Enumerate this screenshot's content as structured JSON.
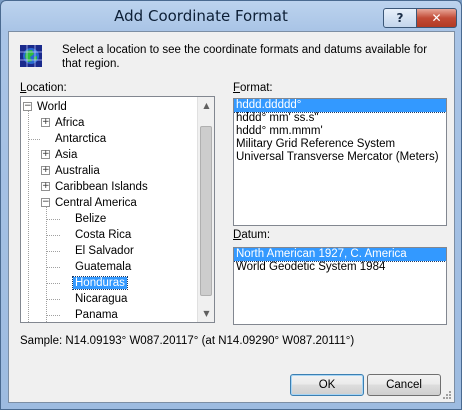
{
  "window": {
    "title": "Add Coordinate Format",
    "help_label": "?",
    "close_label": "✕"
  },
  "intro": {
    "icon": "globe-grid-icon",
    "text": "Select a location to see the coordinate formats and datums available for that region."
  },
  "location": {
    "label_hotkey": "L",
    "label_rest": "ocation:",
    "tree": [
      {
        "label": "World",
        "expander": "−",
        "depth": 0
      },
      {
        "label": "Africa",
        "expander": "+",
        "depth": 1
      },
      {
        "label": "Antarctica",
        "expander": "",
        "depth": 1
      },
      {
        "label": "Asia",
        "expander": "+",
        "depth": 1
      },
      {
        "label": "Australia",
        "expander": "+",
        "depth": 1
      },
      {
        "label": "Caribbean Islands",
        "expander": "+",
        "depth": 1
      },
      {
        "label": "Central America",
        "expander": "−",
        "depth": 1
      },
      {
        "label": "Belize",
        "expander": "",
        "depth": 2
      },
      {
        "label": "Costa Rica",
        "expander": "",
        "depth": 2
      },
      {
        "label": "El Salvador",
        "expander": "",
        "depth": 2
      },
      {
        "label": "Guatemala",
        "expander": "",
        "depth": 2
      },
      {
        "label": "Honduras",
        "expander": "",
        "depth": 2,
        "selected": true
      },
      {
        "label": "Nicaragua",
        "expander": "",
        "depth": 2
      },
      {
        "label": "Panama",
        "expander": "",
        "depth": 2
      }
    ],
    "scroll_up": "▲",
    "scroll_down": "▼"
  },
  "format": {
    "label_hotkey": "F",
    "label_rest": "ormat:",
    "items": [
      "hddd.ddddd°",
      "hddd° mm' ss.s\"",
      "hddd° mm.mmm'",
      "Military Grid Reference System",
      "Universal Transverse Mercator (Meters)"
    ],
    "selected_index": 0
  },
  "datum": {
    "label_hotkey": "D",
    "label_rest": "atum:",
    "items": [
      "North American 1927, C. America",
      "World Geodetic System 1984"
    ],
    "selected_index": 0
  },
  "sample": {
    "text": "Sample: N14.09193°  W087.20117°  (at N14.09290°  W087.20111°)"
  },
  "buttons": {
    "ok": "OK",
    "cancel": "Cancel"
  },
  "colors": {
    "selection": "#3399ff",
    "close_button": "#c24b36",
    "title_bar": "#a9c4e6"
  }
}
